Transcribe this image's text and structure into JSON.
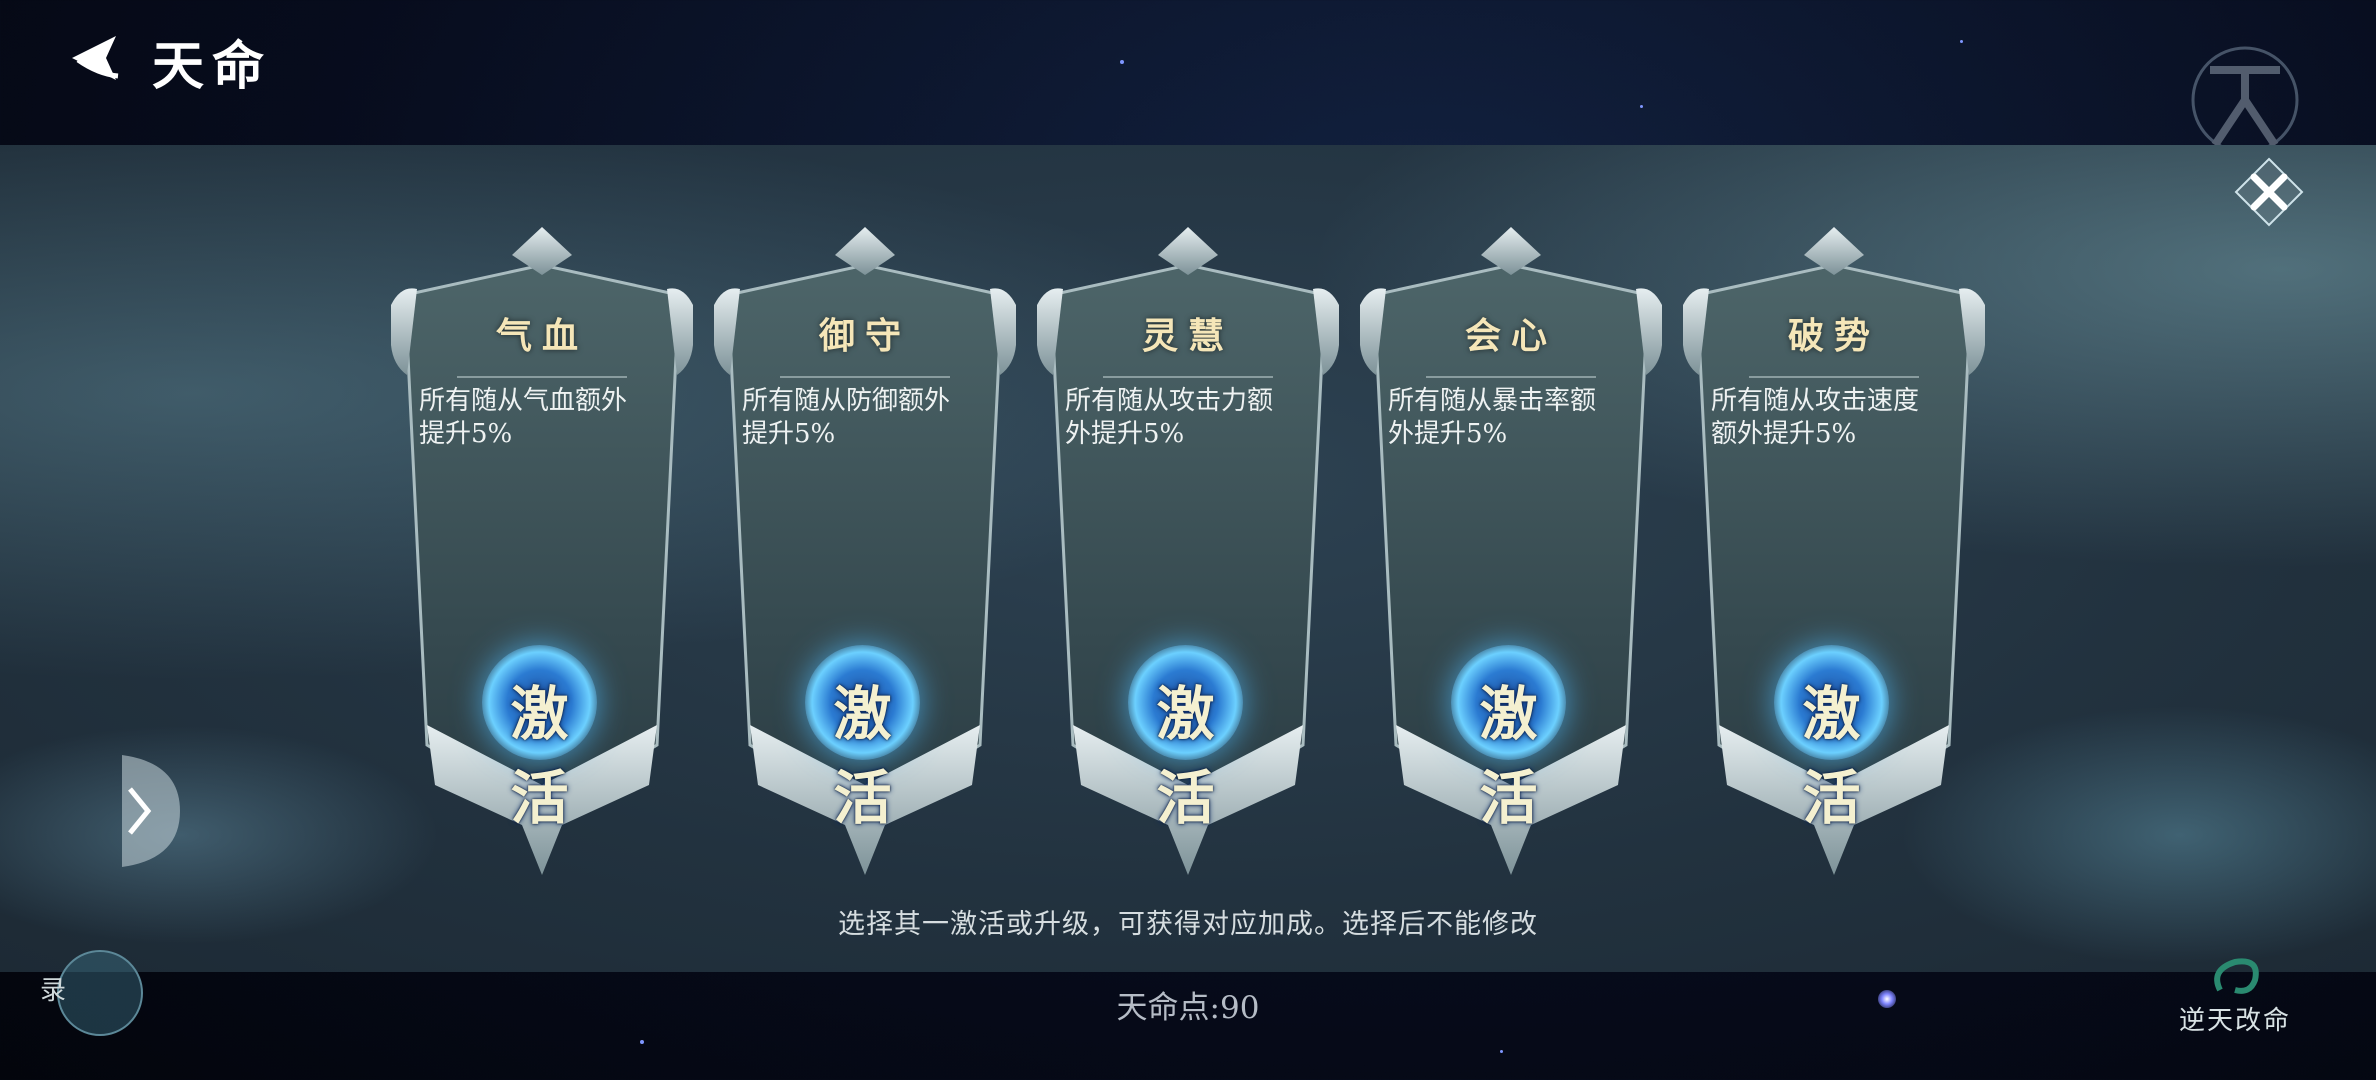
{
  "header": {
    "title": "天命"
  },
  "cards": [
    {
      "title": "气血",
      "desc": "所有随从气血额外提升5%",
      "button": "激活"
    },
    {
      "title": "御守",
      "desc": "所有随从防御额外提升5%",
      "button": "激活"
    },
    {
      "title": "灵慧",
      "desc": "所有随从攻击力额外提升5%",
      "button": "激活"
    },
    {
      "title": "会心",
      "desc": "所有随从暴击率额外提升5%",
      "button": "激活"
    },
    {
      "title": "破势",
      "desc": "所有随从攻击速度额外提升5%",
      "button": "激活"
    }
  ],
  "hint": "选择其一激活或升级，可获得对应加成。选择后不能修改",
  "footer": {
    "points_label": "天命点:90",
    "left_label": "录",
    "fate_button_label": "逆天改命"
  },
  "icons": {
    "back": "back-arrow-icon",
    "close": "close-icon",
    "expand": "chevron-right-icon",
    "emblem": "heaven-emblem-icon"
  },
  "colors": {
    "title_gold": "#f5e6b8",
    "orb_blue": "#2b7bd2",
    "panel_bg": "#2d4252"
  }
}
